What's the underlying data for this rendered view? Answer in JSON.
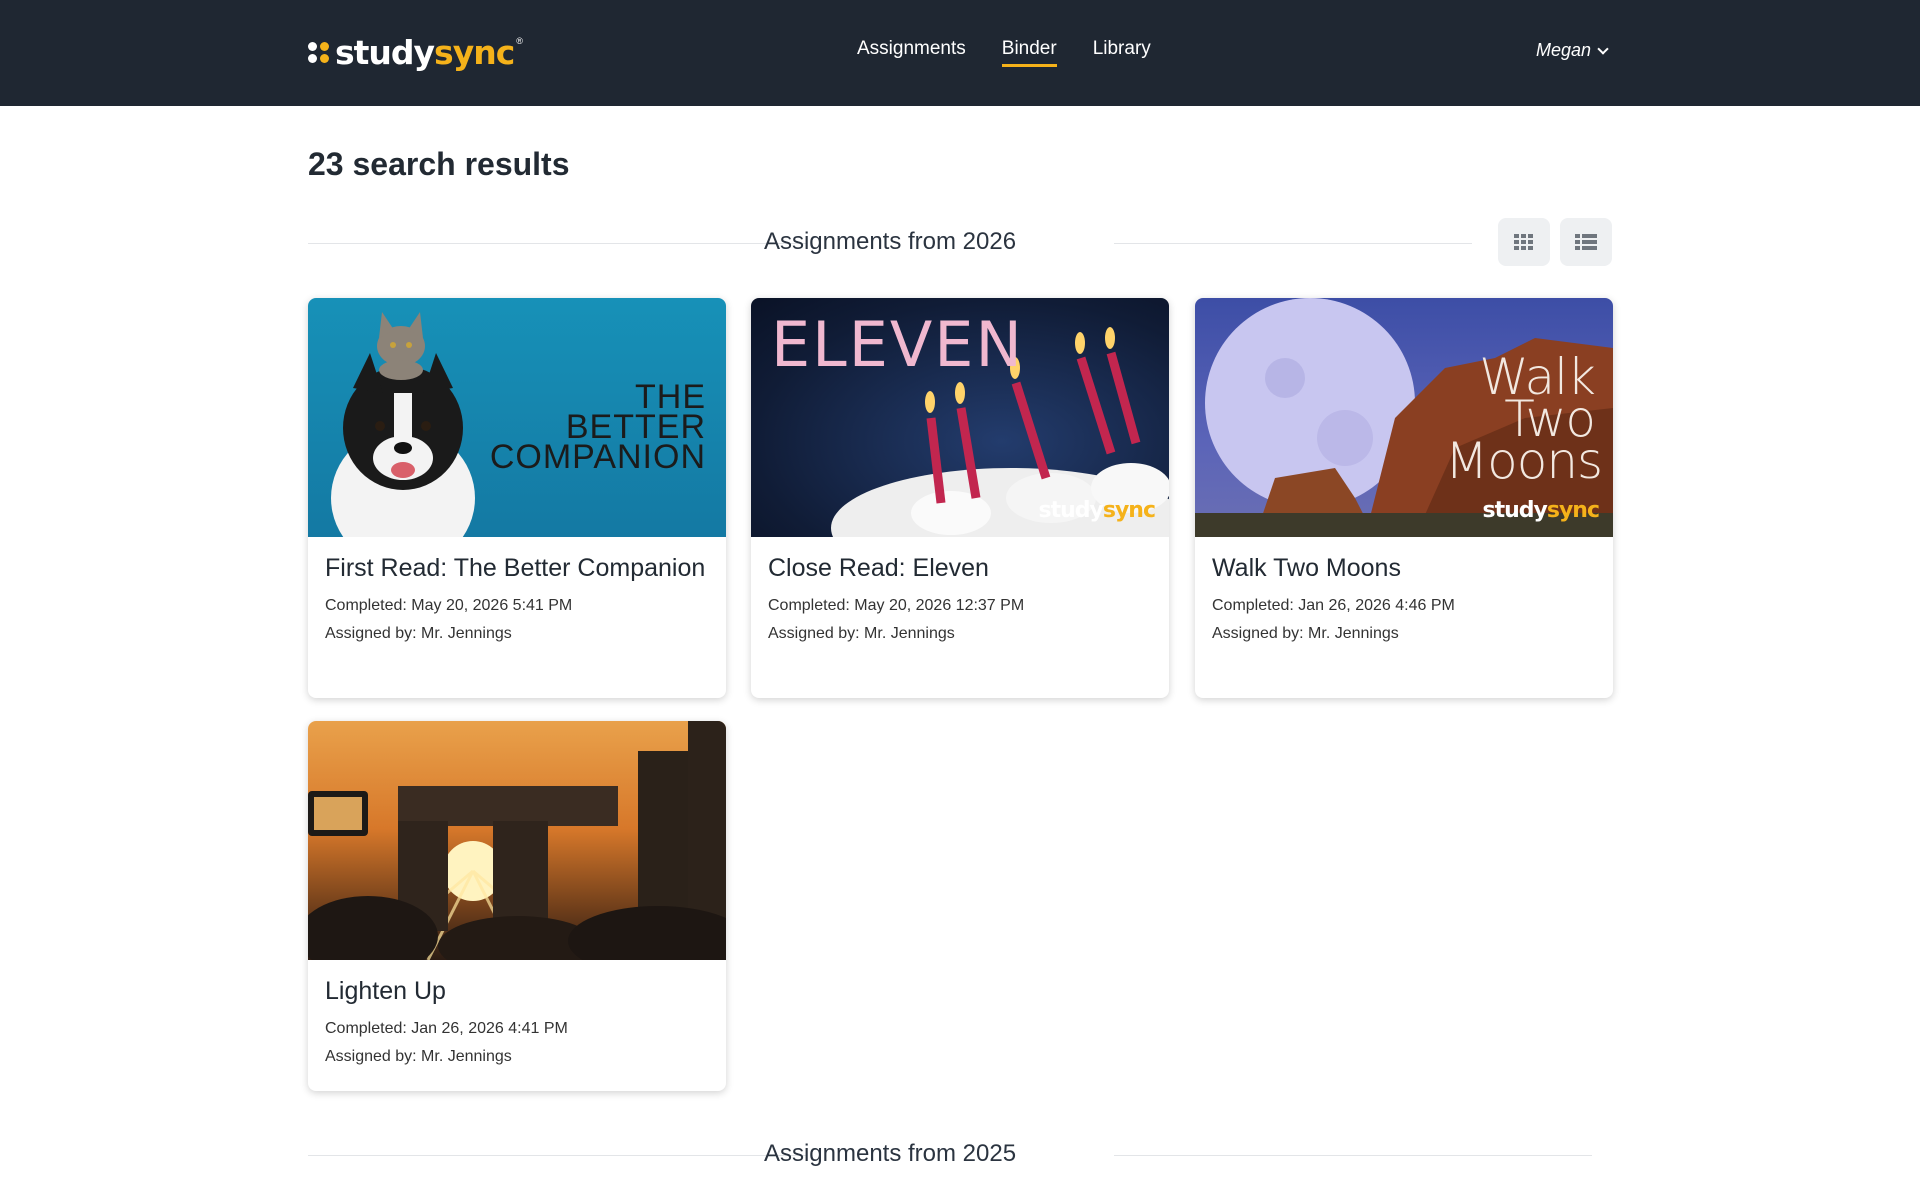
{
  "header": {
    "logo_text_main": "study",
    "logo_text_accent": "sync",
    "logo_tm": "®",
    "nav": [
      {
        "label": "Assignments",
        "active": false
      },
      {
        "label": "Binder",
        "active": true
      },
      {
        "label": "Library",
        "active": false
      }
    ],
    "user_name": "Megan"
  },
  "results_title": "23 search results",
  "sections": [
    {
      "label": "Assignments from 2026"
    },
    {
      "label": "Assignments from 2025"
    }
  ],
  "view_toggles": {
    "grid_icon": "grid-icon",
    "list_icon": "list-icon"
  },
  "cards": [
    {
      "title": "First Read: The Better Companion",
      "completed": "Completed: May 20, 2026 5:41 PM",
      "assigned": "Assigned by: Mr. Jennings",
      "thumb_line1": "THE BETTER",
      "thumb_line2": "COMPANION"
    },
    {
      "title": "Close Read: Eleven",
      "completed": "Completed: May 20, 2026 12:37 PM",
      "assigned": "Assigned by: Mr. Jennings",
      "thumb_line1": "ELEVEN",
      "watermark_main": "study",
      "watermark_accent": "sync"
    },
    {
      "title": "Walk Two Moons",
      "completed": "Completed: Jan 26, 2026 4:46 PM",
      "assigned": "Assigned by: Mr. Jennings",
      "thumb_line1": "Walk",
      "thumb_line2": "Two",
      "thumb_line3": "Moons",
      "watermark_main": "study",
      "watermark_accent": "sync"
    },
    {
      "title": "Lighten Up",
      "completed": "Completed: Jan 26, 2026 4:41 PM",
      "assigned": "Assigned by: Mr. Jennings"
    }
  ],
  "colors": {
    "header_bg": "#1f2732",
    "accent": "#f5b21a"
  }
}
